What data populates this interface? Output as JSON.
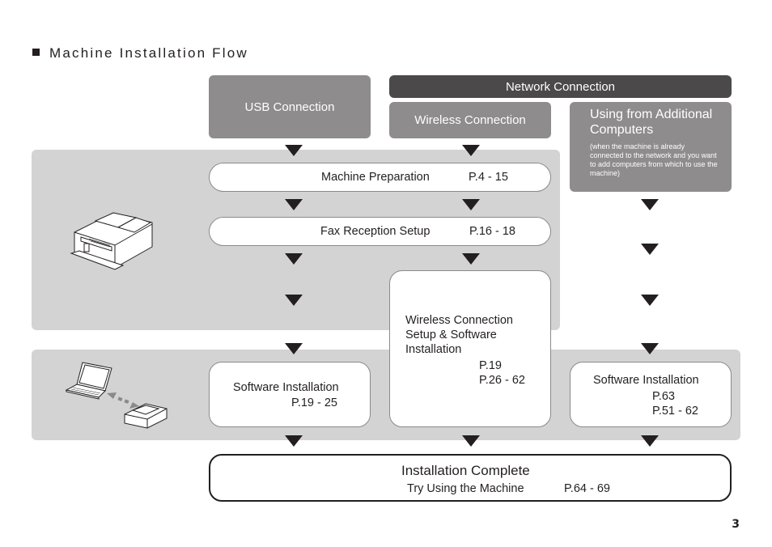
{
  "title": "Machine Installation Flow",
  "headers": {
    "usb": "USB Connection",
    "network": "Network Connection",
    "wireless": "Wireless Connection",
    "additional": {
      "title": "Using from Additional Computers",
      "note": "(when the machine is already connected to the network and you want to add computers from which to use the machine)"
    }
  },
  "steps": {
    "machine_preparation": {
      "label": "Machine Preparation",
      "pages": "P.4 - 15"
    },
    "fax_setup": {
      "label": "Fax Reception Setup",
      "pages": "P.16 - 18"
    },
    "wireless_setup": {
      "label": "Wireless Connection Setup & Software Installation",
      "pages": [
        "P.19",
        "P.26 - 62"
      ]
    },
    "usb_software": {
      "label": "Software Installation",
      "pages": "P.19 - 25"
    },
    "additional_software": {
      "label": "Software Installation",
      "pages": [
        "P.63",
        "P.51 - 62"
      ]
    },
    "complete": {
      "label": "Installation Complete",
      "sublabel": "Try Using the Machine",
      "pages": "P.64 - 69"
    }
  },
  "illustrations": {
    "printer": "printer-illustration",
    "laptop_printer": "laptop-printer-connection-illustration"
  },
  "page_number": "3"
}
